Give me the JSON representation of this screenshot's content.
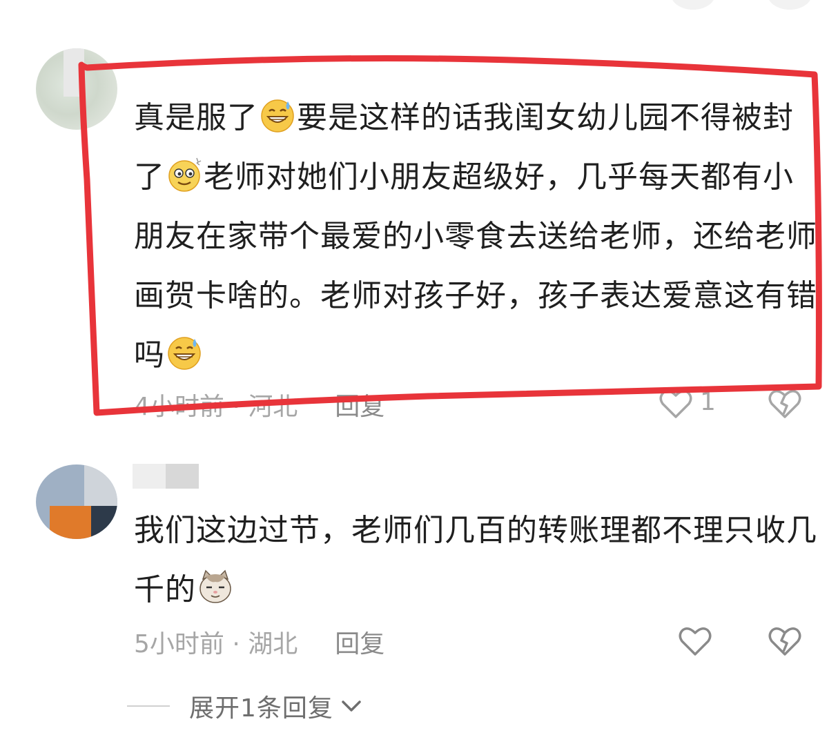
{
  "comments": [
    {
      "text_parts": [
        "真是服了",
        "要是这样的话我闺女幼儿园不得被封了",
        "老师对她们小朋友超级好，几乎每天都有小朋友在家带个最爱的小零食去送给老师，还给老师画贺卡啥的。老师对孩子好，孩子表达爱意这有错吗",
        ""
      ],
      "time": "4小时前",
      "location": "河北",
      "reply_label": "回复",
      "like_count": "1"
    },
    {
      "text_parts": [
        "我们这边过节，老师们几百的转账理都不理只收几千的",
        ""
      ],
      "time": "5小时前",
      "location": "湖北",
      "reply_label": "回复",
      "like_count": ""
    }
  ],
  "expand_replies": {
    "label": "展开1条回复"
  },
  "colors": {
    "highlight_stroke": "#e8343a",
    "meta_text": "#a6a6a6",
    "body_text": "#1f1f1f"
  },
  "icons": [
    "sweat-grin-emoji",
    "dizzy-face-emoji",
    "smug-cat-emoji",
    "heart-icon",
    "broken-heart-icon",
    "chevron-down-icon"
  ]
}
